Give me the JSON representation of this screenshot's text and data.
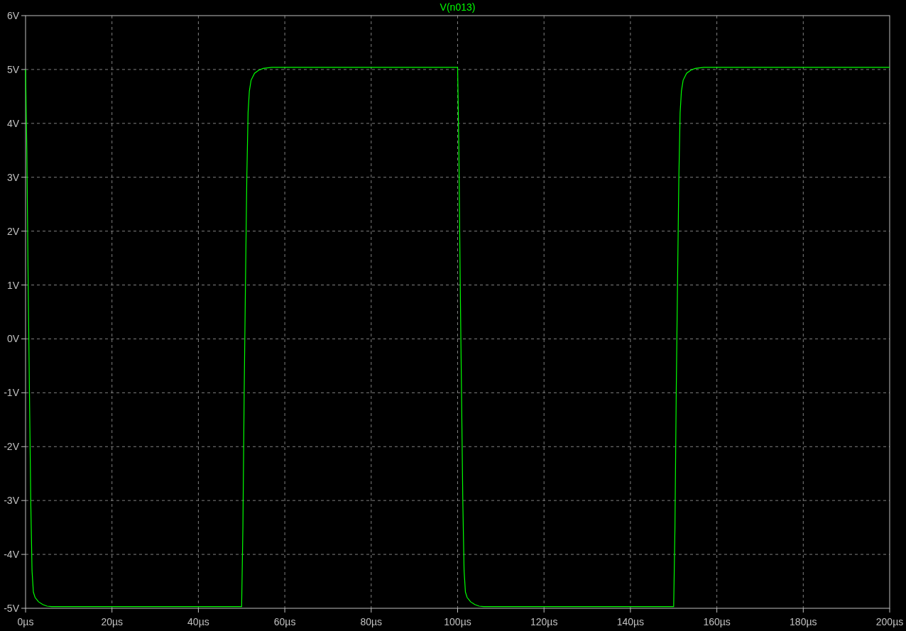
{
  "plot": {
    "chart_data": {
      "type": "line",
      "grid": true,
      "x": [
        0,
        0.3,
        0.6,
        0.9,
        1.2,
        1.5,
        1.8,
        2.2,
        3,
        4,
        5,
        6,
        50,
        50.3,
        50.6,
        50.9,
        51.2,
        51.5,
        51.8,
        52.2,
        53,
        54,
        55,
        57,
        100,
        100.3,
        100.6,
        100.9,
        101.2,
        101.5,
        101.8,
        102.2,
        103,
        104,
        105,
        106,
        150,
        150.3,
        150.6,
        150.9,
        151.2,
        151.5,
        151.8,
        152.2,
        153,
        154,
        155,
        157,
        200
      ],
      "series": [
        {
          "name": "V(n013)",
          "color": "#00ff00",
          "values": [
            5,
            3.5,
            1,
            -1,
            -3,
            -4.3,
            -4.7,
            -4.8,
            -4.88,
            -4.93,
            -4.96,
            -4.97,
            -4.97,
            -3.5,
            -1,
            1,
            3,
            4.2,
            4.6,
            4.8,
            4.93,
            4.99,
            5.02,
            5.04,
            5.04,
            3.5,
            1,
            -1,
            -3,
            -4.3,
            -4.7,
            -4.8,
            -4.88,
            -4.93,
            -4.96,
            -4.97,
            -4.97,
            -3.5,
            -1,
            1,
            3,
            4.2,
            4.6,
            4.8,
            4.93,
            4.99,
            5.02,
            5.04,
            5.04
          ]
        }
      ],
      "xlim": [
        0,
        200
      ],
      "ylim": [
        -5,
        6
      ],
      "xticks": [
        {
          "value": 0,
          "label": "0µs"
        },
        {
          "value": 20,
          "label": "20µs"
        },
        {
          "value": 40,
          "label": "40µs"
        },
        {
          "value": 60,
          "label": "60µs"
        },
        {
          "value": 80,
          "label": "80µs"
        },
        {
          "value": 100,
          "label": "100µs"
        },
        {
          "value": 120,
          "label": "120µs"
        },
        {
          "value": 140,
          "label": "140µs"
        },
        {
          "value": 160,
          "label": "160µs"
        },
        {
          "value": 180,
          "label": "180µs"
        },
        {
          "value": 200,
          "label": "200µs"
        }
      ],
      "yticks": [
        {
          "value": 6,
          "label": "6V"
        },
        {
          "value": 5,
          "label": "5V"
        },
        {
          "value": 4,
          "label": "4V"
        },
        {
          "value": 3,
          "label": "3V"
        },
        {
          "value": 2,
          "label": "2V"
        },
        {
          "value": 1,
          "label": "1V"
        },
        {
          "value": 0,
          "label": "0V"
        },
        {
          "value": -1,
          "label": "-1V"
        },
        {
          "value": -2,
          "label": "-2V"
        },
        {
          "value": -3,
          "label": "-3V"
        },
        {
          "value": -4,
          "label": "-4V"
        },
        {
          "value": -5,
          "label": "-5V"
        }
      ]
    }
  }
}
